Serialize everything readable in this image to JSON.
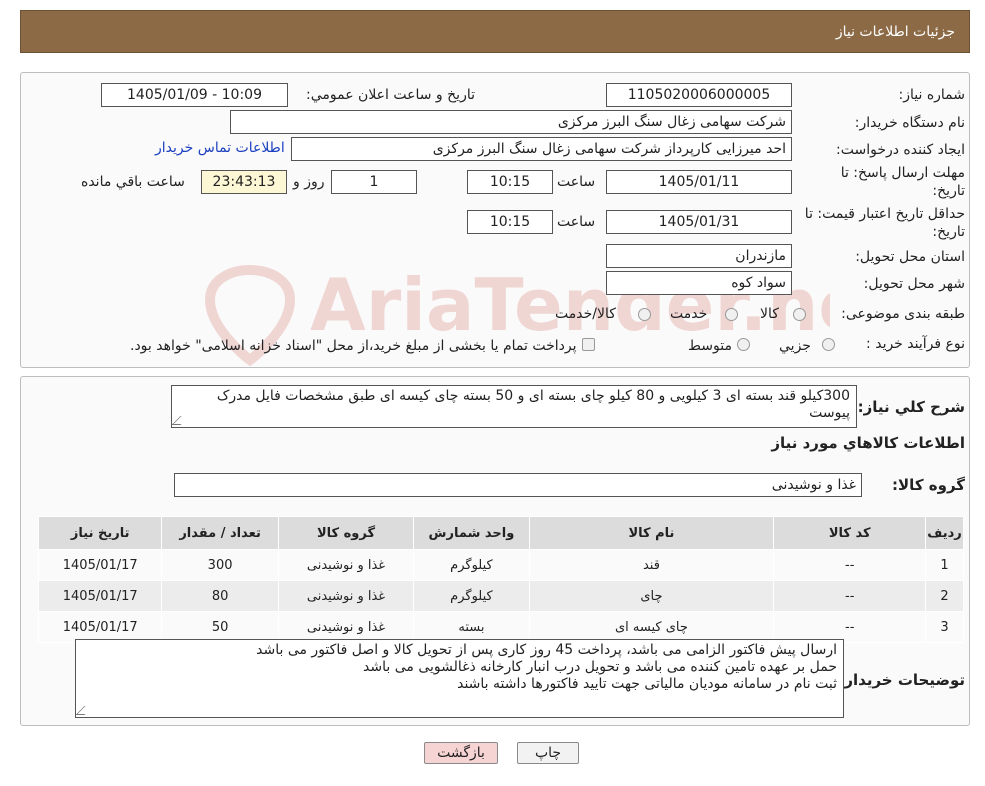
{
  "header": {
    "title": "جزئیات اطلاعات نیاز"
  },
  "form": {
    "need_number_label": "شماره نیاز:",
    "need_number": "1105020006000005",
    "announce_label": "تاریخ و ساعت اعلان عمومي:",
    "announce_value": "1405/01/09 - 10:09",
    "buyer_org_label": "نام دستگاه خریدار:",
    "buyer_org": "شرکت سهامی زغال سنگ البرز مرکزی",
    "creator_label": "ایجاد کننده درخواست:",
    "creator": "احد میرزایی کارپرداز شرکت سهامی زغال سنگ البرز مرکزی",
    "contact_link": "اطلاعات تماس خریدار",
    "deadline_label_1": "مهلت ارسال پاسخ: تا",
    "deadline_label_2": "تاریخ:",
    "deadline_date": "1405/01/11",
    "time_label": "ساعت",
    "deadline_time": "10:15",
    "days_value": "1",
    "days_label": "روز و",
    "remaining_value": "23:43:13",
    "remaining_label": "ساعت باقي مانده",
    "validity_label_1": "حداقل تاریخ اعتبار قیمت: تا",
    "validity_label_2": "تاریخ:",
    "validity_date": "1405/01/31",
    "validity_time": "10:15",
    "province_label": "استان محل تحویل:",
    "province": "مازندران",
    "city_label": "شهر محل تحویل:",
    "city": "سواد کوه",
    "category_label": "طبقه بندی موضوعی:",
    "category_options": [
      "کالا",
      "خدمت",
      "کالا/خدمت"
    ],
    "process_label": "نوع فرآیند خرید :",
    "process_options": [
      "جزیي",
      "متوسط"
    ],
    "process_note": "پرداخت تمام یا بخشی از مبلغ خرید،از محل \"اسناد خزانه اسلامی\" خواهد بود."
  },
  "summary": {
    "label": "شرح کلي نياز:",
    "text": "300کیلو قند بسته ای 3 کیلویی و 80 کیلو چای بسته ای و 50 بسته چای کیسه ای طبق مشخصات فایل مدرک پیوست"
  },
  "goods": {
    "section_title": "اطلاعات کالاهاي مورد نياز",
    "group_label": "گروه کالا:",
    "group_value": "غذا و نوشیدنی",
    "columns": [
      "رديف",
      "کد کالا",
      "نام کالا",
      "واحد شمارش",
      "گروه کالا",
      "تعداد / مقدار",
      "تاریخ نیاز"
    ],
    "rows": [
      [
        "1",
        "--",
        "قند",
        "کیلوگرم",
        "غذا و نوشیدنی",
        "300",
        "1405/01/17"
      ],
      [
        "2",
        "--",
        "چای",
        "کیلوگرم",
        "غذا و نوشیدنی",
        "80",
        "1405/01/17"
      ],
      [
        "3",
        "--",
        "چای کیسه ای",
        "بسته",
        "غذا و نوشیدنی",
        "50",
        "1405/01/17"
      ]
    ]
  },
  "buyer_notes": {
    "label": "توضیحات خریدار:",
    "lines": [
      "ارسال پیش فاکتور الزامی می باشد، پرداخت 45 روز کاری پس از تحویل کالا و اصل فاکتور می باشد",
      "حمل بر عهده تامین کننده می باشد و تحویل درب انبار کارخانه ذغالشویی می باشد",
      "ثبت نام در سامانه مودیان مالیاتی جهت تایید فاکتورها داشته باشند"
    ]
  },
  "buttons": {
    "print": "چاپ",
    "back": "بازگشت"
  },
  "watermark": {
    "text": "AriaTender.neT"
  },
  "colors": {
    "header_bg": "#8b6a45",
    "link": "#1a3fbf",
    "back_button_bg": "#f7d4d4",
    "remaining_bg": "#fdf7d6"
  }
}
